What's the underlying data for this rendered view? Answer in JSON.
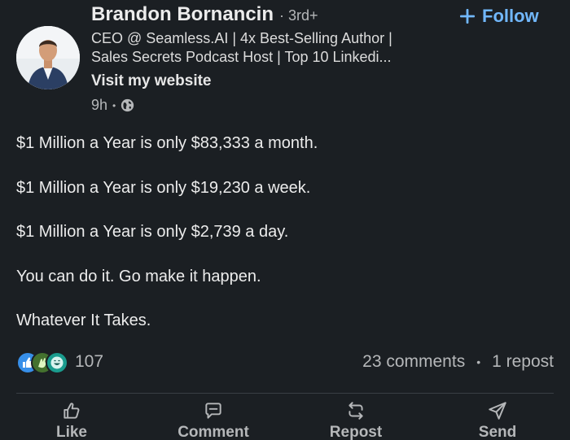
{
  "post": {
    "author": {
      "name": "Brandon Bornancin",
      "degree": "· 3rd+",
      "headline_line1": "CEO @ Seamless.AI | 4x Best-Selling Author |",
      "headline_line2": "Sales Secrets Podcast Host | Top 10 Linkedi...",
      "website_label": "Visit my website",
      "follow_label": "Follow"
    },
    "meta": {
      "time": "9h",
      "separator": "•",
      "visibility_icon": "globe-icon"
    },
    "paragraphs": [
      "$1 Million a Year is only $83,333 a month.",
      "$1 Million a Year is only $19,230 a week.",
      "$1 Million a Year is only $2,739 a day.",
      "You can do it. Go make it happen.",
      "Whatever It Takes."
    ],
    "social": {
      "reaction_icons": [
        "like-reaction-icon",
        "celebrate-reaction-icon",
        "funny-reaction-icon"
      ],
      "reaction_count": "107",
      "comments": "23 comments",
      "separator": "•",
      "reposts": "1 repost"
    }
  },
  "actions": {
    "like": {
      "label": "Like",
      "icon": "thumbs-up-icon"
    },
    "comment": {
      "label": "Comment",
      "icon": "comment-icon"
    },
    "repost": {
      "label": "Repost",
      "icon": "repost-icon"
    },
    "send": {
      "label": "Send",
      "icon": "send-icon"
    }
  },
  "colors": {
    "background": "#1b1f23",
    "link_blue": "#71b7fb",
    "primary_text": "#ececec",
    "secondary_text": "#b5b7b9"
  }
}
